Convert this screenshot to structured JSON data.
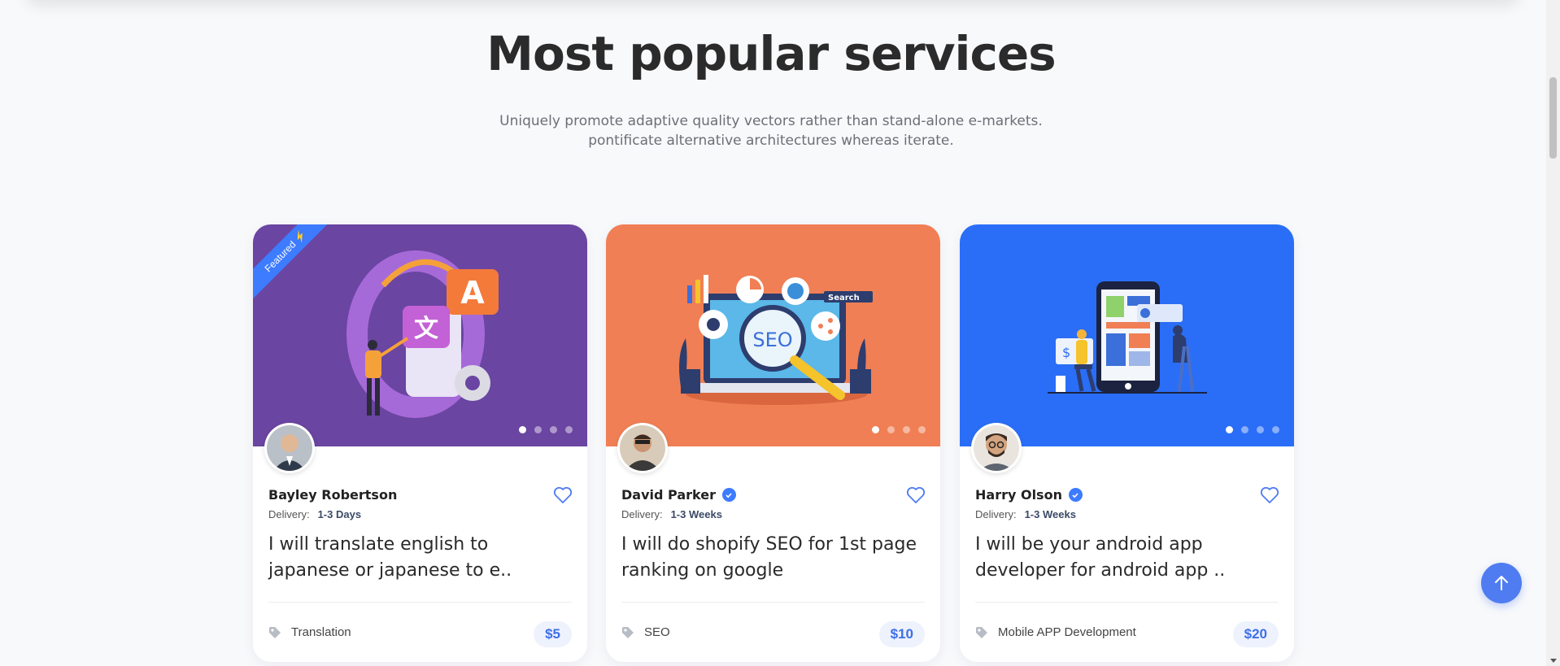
{
  "section": {
    "title": "Most popular services",
    "subtitle": "Uniquely promote adaptive quality vectors rather than stand-alone e-markets. pontificate alternative architectures whereas iterate."
  },
  "colors": {
    "accent": "#3d7bff",
    "card1_bg": "#6a45a1",
    "card2_bg": "#f07f55",
    "card3_bg": "#2a6ef7",
    "price_bg": "#eef2fd",
    "price_text": "#3d6fe8"
  },
  "cards": [
    {
      "ribbon": "Featured",
      "seller": "Bayley Robertson",
      "verified": false,
      "delivery_label": "Delivery:",
      "delivery_value": "1-3 Days",
      "title": "I will translate english to japanese or japanese to e..",
      "category": "Translation",
      "price": "$5",
      "image_icon": "translation-illustration"
    },
    {
      "seller": "David Parker",
      "verified": true,
      "delivery_label": "Delivery:",
      "delivery_value": "1-3 Weeks",
      "title": "I will do shopify SEO for 1st page ranking on google",
      "category": "SEO",
      "price": "$10",
      "image_icon": "seo-illustration",
      "image_text": {
        "search": "Search",
        "seo": "SEO"
      }
    },
    {
      "seller": "Harry Olson",
      "verified": true,
      "delivery_label": "Delivery:",
      "delivery_value": "1-3 Weeks",
      "title": "I will be your android app developer for android app ..",
      "category": "Mobile APP Development",
      "price": "$20",
      "image_icon": "mobile-app-illustration"
    }
  ],
  "image_glyphs": {
    "a": "A",
    "wen": "文",
    "dollar": "$"
  }
}
